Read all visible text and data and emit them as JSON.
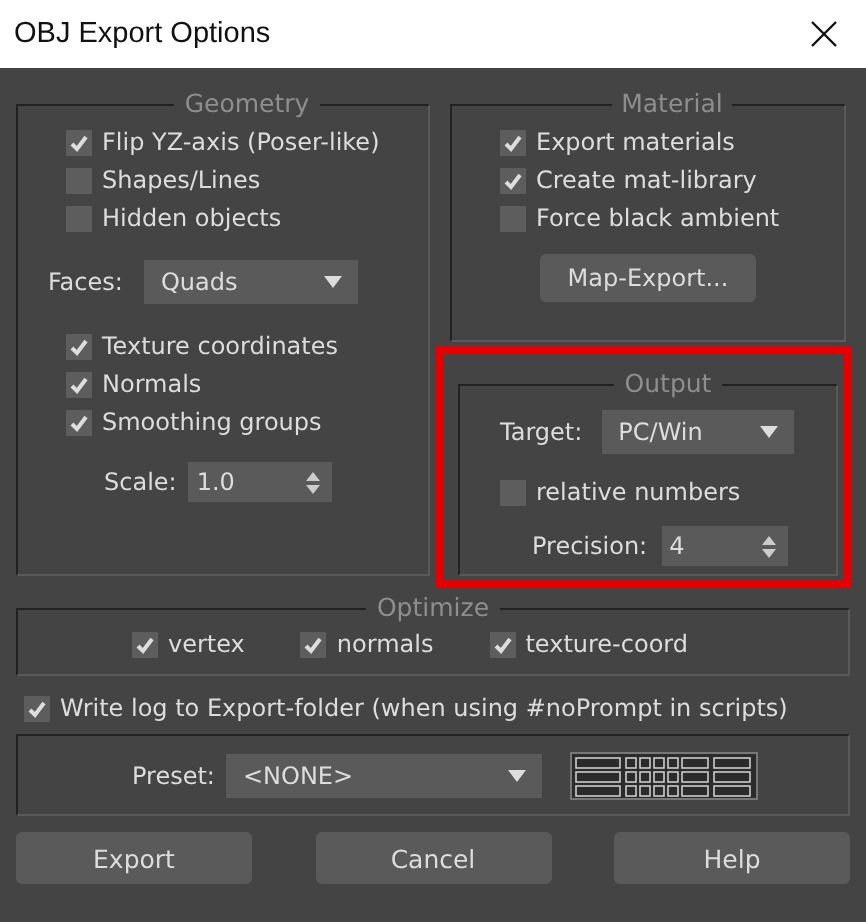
{
  "window": {
    "title": "OBJ Export Options"
  },
  "geometry": {
    "title": "Geometry",
    "flags": [
      {
        "label": "Flip YZ-axis (Poser-like)",
        "checked": true
      },
      {
        "label": "Shapes/Lines",
        "checked": false
      },
      {
        "label": "Hidden objects",
        "checked": false
      }
    ],
    "faces": {
      "label": "Faces:",
      "value": "Quads"
    },
    "channels": [
      {
        "label": "Texture coordinates",
        "checked": true
      },
      {
        "label": "Normals",
        "checked": true
      },
      {
        "label": "Smoothing groups",
        "checked": true
      }
    ],
    "scale": {
      "label": "Scale:",
      "value": "1.0"
    }
  },
  "material": {
    "title": "Material",
    "flags": [
      {
        "label": "Export materials",
        "checked": true
      },
      {
        "label": "Create mat-library",
        "checked": true
      },
      {
        "label": "Force black ambient",
        "checked": false
      }
    ],
    "button": "Map-Export..."
  },
  "output": {
    "title": "Output",
    "highlighted": true,
    "target": {
      "label": "Target:",
      "value": "PC/Win"
    },
    "relative": {
      "label": "relative numbers",
      "checked": false
    },
    "precision": {
      "label": "Precision:",
      "value": "4"
    }
  },
  "optimize": {
    "title": "Optimize",
    "flags": [
      {
        "label": "vertex",
        "checked": true
      },
      {
        "label": "normals",
        "checked": true
      },
      {
        "label": "texture-coord",
        "checked": true
      }
    ]
  },
  "write_log": {
    "label": "Write log to Export-folder (when using #noPrompt in scripts)",
    "checked": true
  },
  "preset": {
    "label": "Preset:",
    "value": "<NONE>"
  },
  "buttons": [
    "Export",
    "Cancel",
    "Help"
  ]
}
